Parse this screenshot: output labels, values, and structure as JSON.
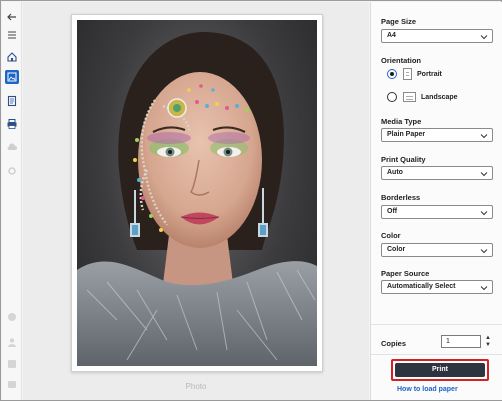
{
  "preview": {
    "page_label": "Photo"
  },
  "rail": {
    "icons": [
      "back-arrow-icon",
      "hamburger-menu-icon",
      "home-icon",
      "photo-layout-icon",
      "document-icon",
      "printer-icon"
    ]
  },
  "panel": {
    "page_size": {
      "label": "Page Size",
      "value": "A4"
    },
    "orientation": {
      "label": "Orientation",
      "options": [
        {
          "label": "Portrait",
          "selected": true
        },
        {
          "label": "Landscape",
          "selected": false
        }
      ]
    },
    "media_type": {
      "label": "Media Type",
      "value": "Plain Paper"
    },
    "print_quality": {
      "label": "Print Quality",
      "value": "Auto"
    },
    "borderless": {
      "label": "Borderless",
      "value": "Off"
    },
    "color": {
      "label": "Color",
      "value": "Color"
    },
    "paper_source": {
      "label": "Paper Source",
      "value": "Automatically Select"
    },
    "copies": {
      "label": "Copies",
      "value": "1"
    },
    "print_button": "Print",
    "help_link": "How to load paper"
  },
  "colors": {
    "accent": "#1e63c7",
    "print_button": "#2d3440",
    "highlight": "#d42020"
  }
}
